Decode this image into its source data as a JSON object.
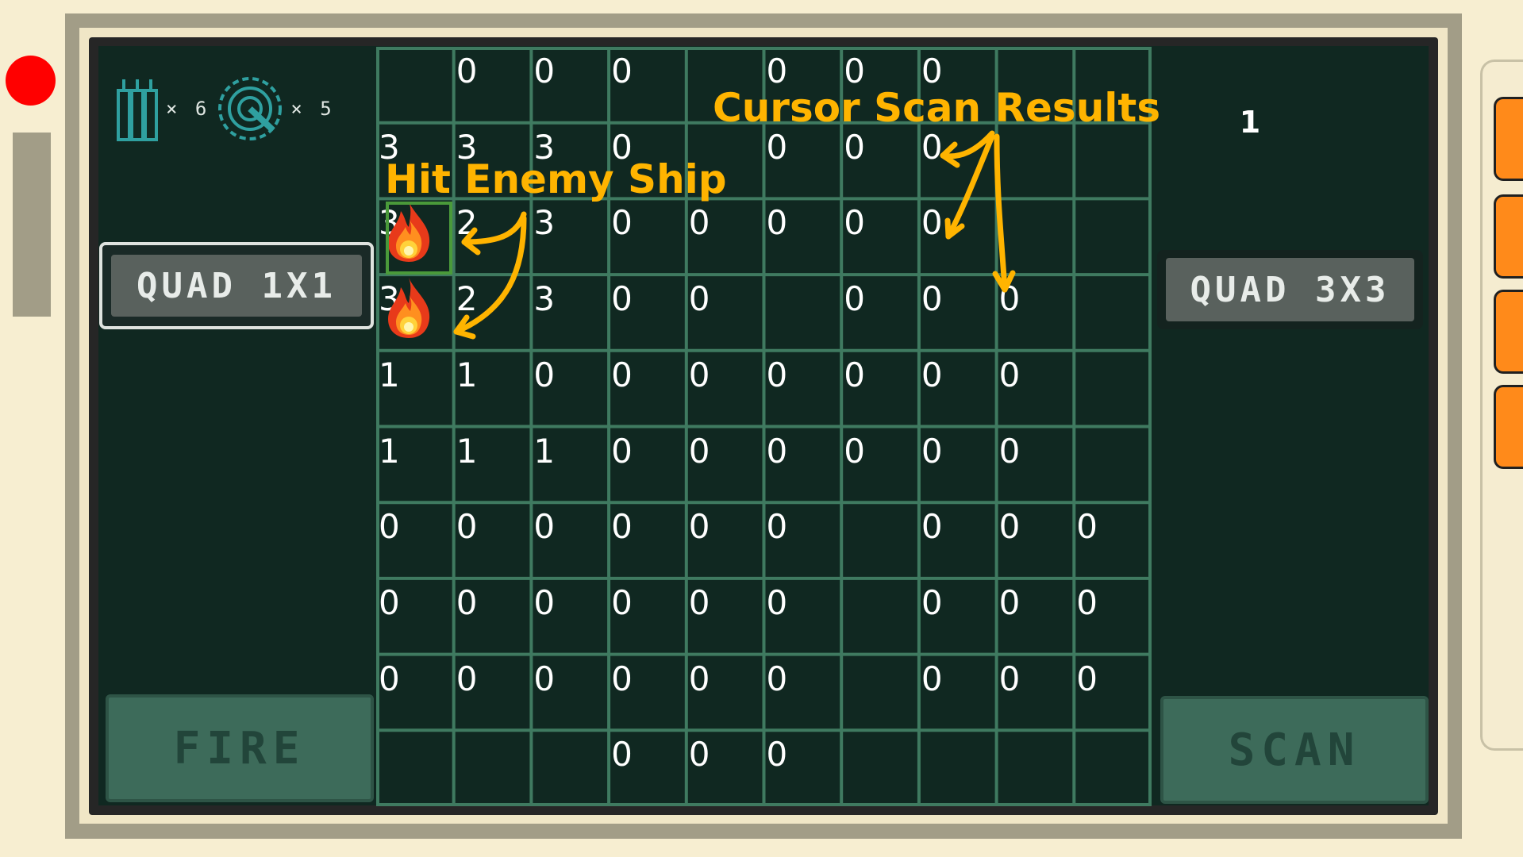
{
  "inventory": {
    "missiles_count": "× 6",
    "radar_count": "× 5"
  },
  "modes": {
    "left_label": "QUAD 1X1",
    "right_label": "QUAD 3X3"
  },
  "actions": {
    "fire_label": "FIRE",
    "scan_label": "SCAN"
  },
  "counter": "1",
  "annotations": {
    "hit": "Hit Enemy Ship",
    "scan": "Cursor Scan Results"
  },
  "board": {
    "cols": 10,
    "rows": 10,
    "cells": [
      [
        "",
        "0",
        "0",
        "0",
        "",
        "0",
        "0",
        "0",
        "",
        ""
      ],
      [
        "3",
        "3",
        "3",
        "0",
        "",
        "0",
        "0",
        "0",
        "",
        ""
      ],
      [
        "3",
        "2",
        "3",
        "0",
        "0",
        "0",
        "0",
        "0",
        "",
        ""
      ],
      [
        "3",
        "2",
        "3",
        "0",
        "0",
        "",
        "0",
        "0",
        "0",
        ""
      ],
      [
        "1",
        "1",
        "0",
        "0",
        "0",
        "0",
        "0",
        "0",
        "0",
        ""
      ],
      [
        "1",
        "1",
        "1",
        "0",
        "0",
        "0",
        "0",
        "0",
        "0",
        ""
      ],
      [
        "0",
        "0",
        "0",
        "0",
        "0",
        "0",
        "",
        "0",
        "0",
        "0"
      ],
      [
        "0",
        "0",
        "0",
        "0",
        "0",
        "0",
        "",
        "0",
        "0",
        "0"
      ],
      [
        "0",
        "0",
        "0",
        "0",
        "0",
        "0",
        "",
        "0",
        "0",
        "0"
      ],
      [
        "",
        "",
        "",
        "0",
        "0",
        "0",
        "",
        "",
        "",
        ""
      ]
    ],
    "hits": [
      [
        2,
        0
      ],
      [
        3,
        0
      ]
    ]
  },
  "colors": {
    "background": "#f7eed1",
    "screen": "#102821",
    "grid_line": "#3f7a60",
    "annotation": "#ffb400",
    "fire_button": "#3d6b5a",
    "record_dot": "#ff0000",
    "side_tab": "#ff8a1a"
  }
}
